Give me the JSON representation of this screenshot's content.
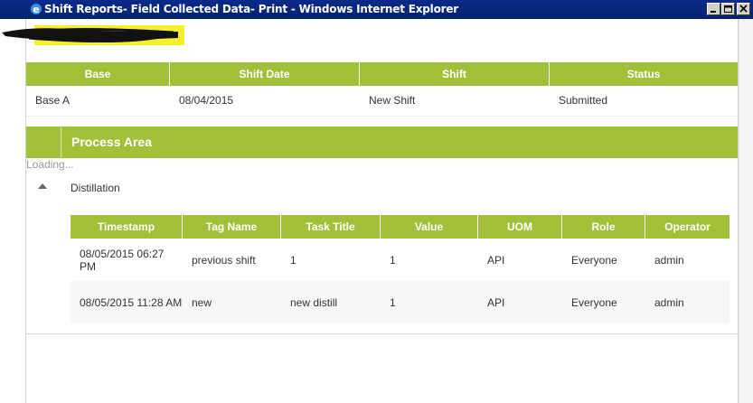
{
  "window": {
    "title": "Shift Reports- Field Collected Data- Print - Windows Internet Explorer"
  },
  "header_table": {
    "columns": [
      "Base",
      "Shift Date",
      "Shift",
      "Status"
    ],
    "row": [
      "Base A",
      "08/04/2015",
      "New Shift",
      "Submitted"
    ]
  },
  "process_area": {
    "title": "Process Area",
    "loading_text": "Loading...",
    "area_name": "Distillation"
  },
  "detail_table": {
    "columns": [
      "Timestamp",
      "Tag Name",
      "Task Title",
      "Value",
      "UOM",
      "Role",
      "Operator"
    ],
    "rows": [
      [
        "08/05/2015 06:27 PM",
        "previous shift",
        "1",
        "1",
        "API",
        "Everyone",
        "admin"
      ],
      [
        "08/05/2015 11:28 AM",
        "new",
        "new distill",
        "1",
        "API",
        "Everyone",
        "admin"
      ]
    ]
  },
  "colors": {
    "accent": "#a3c03b",
    "titlebar": "#0a2a8a"
  }
}
